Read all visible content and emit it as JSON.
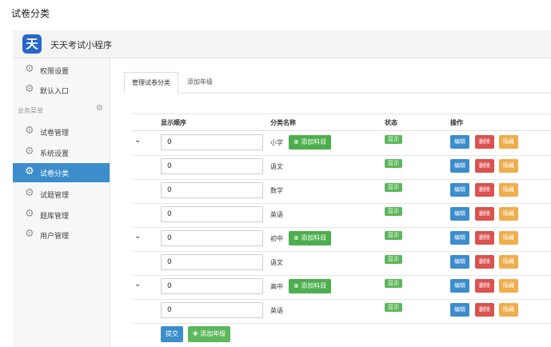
{
  "page": {
    "title": "试卷分类"
  },
  "app": {
    "logo_char": "天",
    "name": "天天考试小程序"
  },
  "sidebar": {
    "items_top": [
      {
        "label": "权限设置"
      },
      {
        "label": "默认入口"
      }
    ],
    "section_label": "业务菜单",
    "items": [
      {
        "label": "试卷管理"
      },
      {
        "label": "系统设置"
      },
      {
        "label": "试卷分类"
      },
      {
        "label": "试题管理"
      },
      {
        "label": "题库管理"
      },
      {
        "label": "用户管理"
      }
    ]
  },
  "tabs": [
    {
      "label": "管理试卷分类"
    },
    {
      "label": "添加年级"
    }
  ],
  "table": {
    "headers": {
      "order": "显示顺序",
      "name": "分类名称",
      "status": "状态",
      "ops": "操作"
    },
    "rows": [
      {
        "order": "0",
        "name": "小学",
        "status": "显示",
        "is_grade": true
      },
      {
        "order": "0",
        "name": "语文",
        "status": "显示",
        "is_grade": false
      },
      {
        "order": "0",
        "name": "数学",
        "status": "显示",
        "is_grade": false
      },
      {
        "order": "0",
        "name": "英语",
        "status": "显示",
        "is_grade": false
      },
      {
        "order": "0",
        "name": "初中",
        "status": "显示",
        "is_grade": true
      },
      {
        "order": "0",
        "name": "语文",
        "status": "显示",
        "is_grade": false
      },
      {
        "order": "0",
        "name": "高中",
        "status": "显示",
        "is_grade": true
      },
      {
        "order": "0",
        "name": "英语",
        "status": "显示",
        "is_grade": false
      }
    ],
    "add_subject_label": "添加科目",
    "edit_label": "编辑",
    "delete_label": "删除",
    "hide_label": "隐藏"
  },
  "actions": {
    "submit_label": "提交",
    "add_grade_label": "添加年级"
  }
}
